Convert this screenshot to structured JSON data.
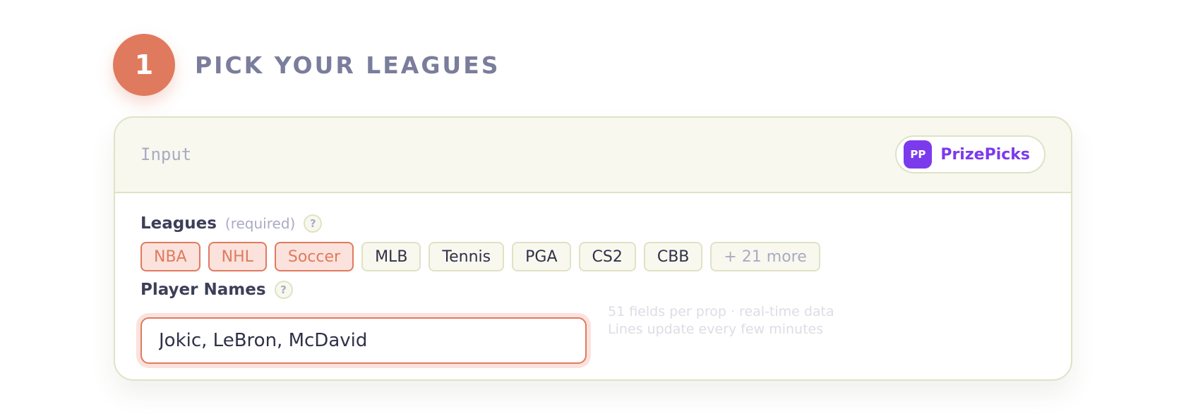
{
  "step": {
    "number": "1",
    "title": "PICK YOUR LEAGUES"
  },
  "card": {
    "header_label": "Input",
    "provider": {
      "logo_text": "PP",
      "name": "PrizePicks",
      "brand_color": "#7c3aed"
    }
  },
  "leagues": {
    "label": "Leagues",
    "hint": "(required)",
    "help": "?",
    "chips": [
      {
        "label": "NBA",
        "selected": true
      },
      {
        "label": "NHL",
        "selected": true
      },
      {
        "label": "Soccer",
        "selected": true
      },
      {
        "label": "MLB",
        "selected": false
      },
      {
        "label": "Tennis",
        "selected": false
      },
      {
        "label": "PGA",
        "selected": false
      },
      {
        "label": "CS2",
        "selected": false
      },
      {
        "label": "CBB",
        "selected": false
      }
    ],
    "more_label": "+ 21 more"
  },
  "players": {
    "label": "Player Names",
    "help": "?",
    "value": "Jokic, LeBron, McDavid"
  },
  "side_note": {
    "line1": "51 fields per prop · real-time data",
    "line2": "Lines update every few minutes"
  },
  "colors": {
    "accent": "#e07a5f",
    "accent_soft": "#fbe2dc",
    "border": "#dfe3c4",
    "header_bg": "#f8f8ef",
    "title": "#7b7d9c"
  }
}
